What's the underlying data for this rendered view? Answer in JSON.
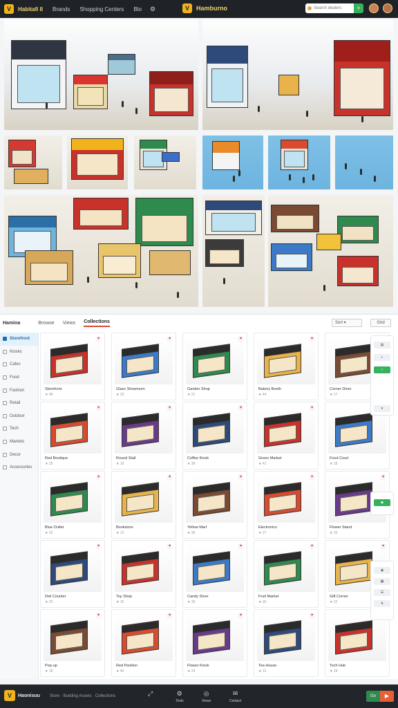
{
  "topbar": {
    "brand": "Habitafi II",
    "links": [
      "Brands",
      "Shopping Centers",
      "Blo"
    ],
    "center_brand": "Hamburno",
    "search_placeholder": "Search dealers",
    "search_button": "+"
  },
  "catalog": {
    "brand": "Hamina",
    "tabs": [
      "Browse",
      "Views",
      "Collections"
    ],
    "active_tab": 2,
    "sort_label": "Sort ▾",
    "view_label": "Grid",
    "sidebar": [
      "Storefront",
      "Kiosks",
      "Cafes",
      "Food",
      "Fashion",
      "Retail",
      "Outdoor",
      "Tech",
      "Markets",
      "Decor",
      "Accessories"
    ],
    "cards": [
      {
        "name": "Storefront",
        "meta": "★ 48"
      },
      {
        "name": "Glass Showroom",
        "meta": "★ 32"
      },
      {
        "name": "Garden Shop",
        "meta": "★ 21"
      },
      {
        "name": "Bakery Booth",
        "meta": "★ 44"
      },
      {
        "name": "Corner Diner",
        "meta": "★ 17"
      },
      {
        "name": "Red Boutique",
        "meta": "★ 25"
      },
      {
        "name": "Round Stall",
        "meta": "★ 19"
      },
      {
        "name": "Coffee Kiosk",
        "meta": "★ 38"
      },
      {
        "name": "Green Market",
        "meta": "★ 41"
      },
      {
        "name": "Food Court",
        "meta": "★ 29"
      },
      {
        "name": "Blue Outlet",
        "meta": "★ 23"
      },
      {
        "name": "Bookstore",
        "meta": "★ 12"
      },
      {
        "name": "Yellow Mart",
        "meta": "★ 36"
      },
      {
        "name": "Electronics",
        "meta": "★ 27"
      },
      {
        "name": "Flower Stand",
        "meta": "★ 33"
      },
      {
        "name": "Deli Counter",
        "meta": "★ 20"
      },
      {
        "name": "Toy Shop",
        "meta": "★ 15"
      },
      {
        "name": "Candy Store",
        "meta": "★ 30"
      },
      {
        "name": "Fruit Market",
        "meta": "★ 26"
      },
      {
        "name": "Gift Corner",
        "meta": "★ 22"
      },
      {
        "name": "Pop-up",
        "meta": "★ 18"
      },
      {
        "name": "Red Pavilion",
        "meta": "★ 40"
      },
      {
        "name": "Flower Kiosk",
        "meta": "★ 24"
      },
      {
        "name": "Tea House",
        "meta": "★ 31"
      },
      {
        "name": "Tech Hub",
        "meta": "★ 28"
      }
    ]
  },
  "footer": {
    "brand": "Haonisuu",
    "tagline": "Store · Building Assets · Collections",
    "nav": [
      {
        "glyph": "⤢",
        "label": ""
      },
      {
        "glyph": "⚙",
        "label": "Tools"
      },
      {
        "glyph": "◎",
        "label": "Views"
      },
      {
        "glyph": "✉",
        "label": "Contact"
      }
    ],
    "btn_left": "Go",
    "btn_right": "▶"
  },
  "colors": {
    "accent": "#f2b21b",
    "topbar": "#1f2328",
    "active": "#1a6fb0"
  }
}
